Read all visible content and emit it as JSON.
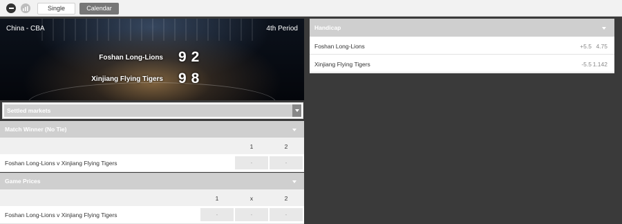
{
  "toolbar": {
    "single_label": "Single",
    "calendar_label": "Calendar"
  },
  "scoreboard": {
    "league": "China - CBA",
    "period": "4th Period",
    "home_team": "Foshan Long-Lions",
    "home_score": "92",
    "away_team": "Xinjiang Flying Tigers",
    "away_score": "98"
  },
  "settled_markets": {
    "label": "Settled markets"
  },
  "markets": [
    {
      "title": "Match Winner (No Tie)",
      "columns": [
        "1",
        "2"
      ],
      "event": "Foshan Long-Lions v Xinjiang Flying Tigers",
      "odds": [
        "-",
        "-"
      ]
    },
    {
      "title": "Game Prices",
      "columns": [
        "1",
        "x",
        "2"
      ],
      "event": "Foshan Long-Lions v Xinjiang Flying Tigers",
      "odds": [
        "-",
        "-",
        "-"
      ]
    }
  ],
  "handicap": {
    "title": "Handicap",
    "rows": [
      {
        "team": "Foshan Long-Lions",
        "line": "+5.5",
        "price": "4.75"
      },
      {
        "team": "Xinjiang Flying Tigers",
        "line": "-5.5",
        "price": "1.142"
      }
    ]
  },
  "icons": {
    "collapse": "minus-circle-icon",
    "stats": "stats-icon",
    "dropdown": "chevron-down-icon"
  },
  "colors": {
    "header_bar": "#cfcfcf",
    "active_tab": "#767676",
    "background": "#3a3a3a"
  }
}
